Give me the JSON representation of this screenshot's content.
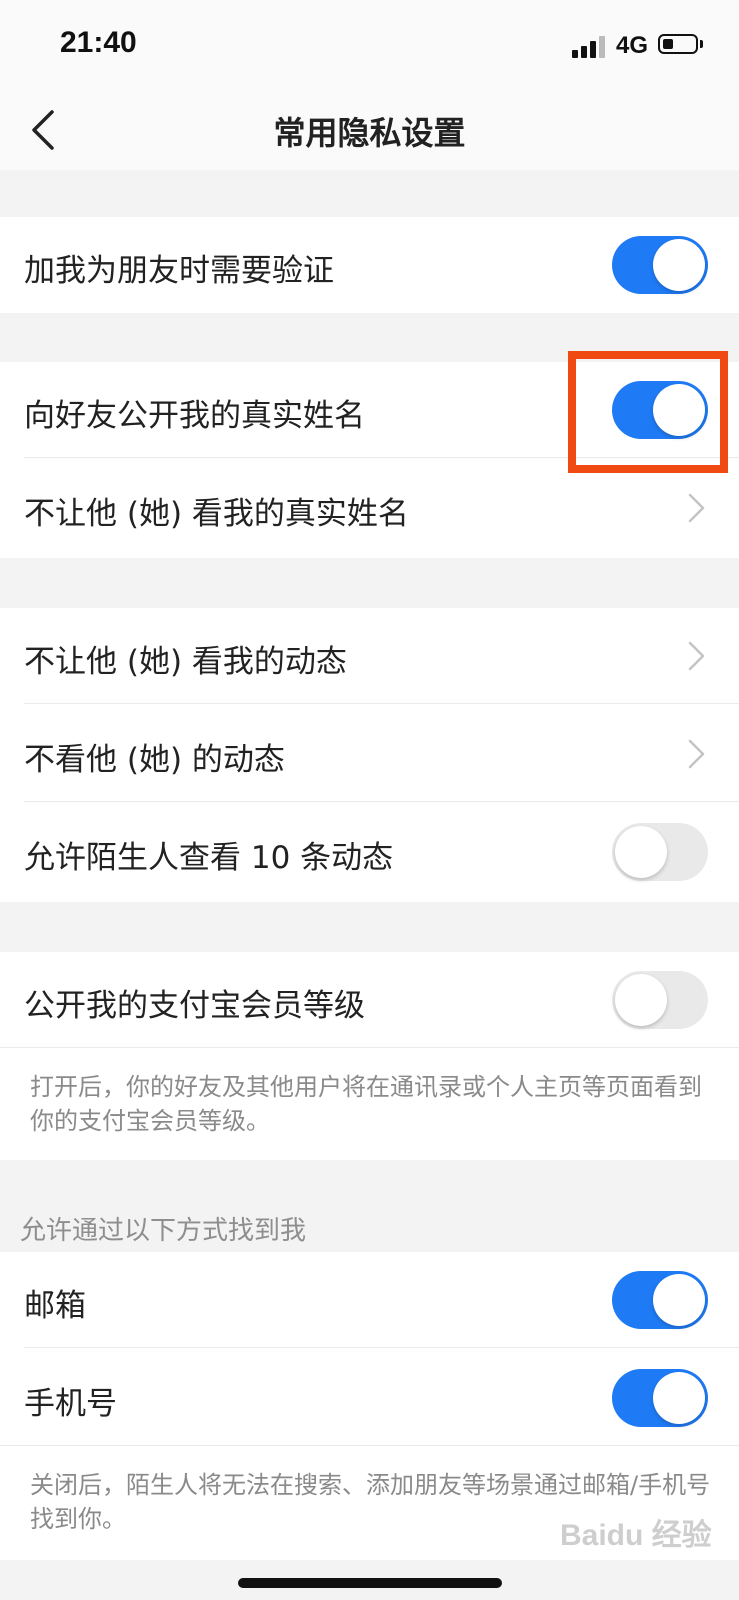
{
  "status_bar": {
    "time": "21:40",
    "network": "4G"
  },
  "nav": {
    "title": "常用隐私设置"
  },
  "groups": {
    "friend_verify": {
      "label": "加我为朋友时需要验证",
      "on": true
    },
    "real_name": {
      "show_name": {
        "label": "向好友公开我的真实姓名",
        "on": true
      },
      "hide_from": {
        "label": "不让他 (她) 看我的真实姓名"
      }
    },
    "moments": {
      "hide_my_moments": {
        "label": "不让他 (她) 看我的动态"
      },
      "dont_see_theirs": {
        "label": "不看他 (她) 的动态"
      },
      "strangers_ten": {
        "label": "允许陌生人查看 10 条动态",
        "on": false
      }
    },
    "membership": {
      "show_level": {
        "label": "公开我的支付宝会员等级",
        "on": false
      },
      "note": "打开后，你的好友及其他用户将在通讯录或个人主页等页面看到你的支付宝会员等级。"
    },
    "find_me": {
      "header": "允许通过以下方式找到我",
      "email": {
        "label": "邮箱",
        "on": true
      },
      "phone": {
        "label": "手机号",
        "on": true
      },
      "note": "关闭后，陌生人将无法在搜索、添加朋友等场景通过邮箱/手机号找到你。"
    }
  },
  "watermark": "Baidu 经验",
  "colors": {
    "toggle_on": "#1f7bf5",
    "toggle_off": "#e9e9ea",
    "highlight": "#f04a12"
  }
}
